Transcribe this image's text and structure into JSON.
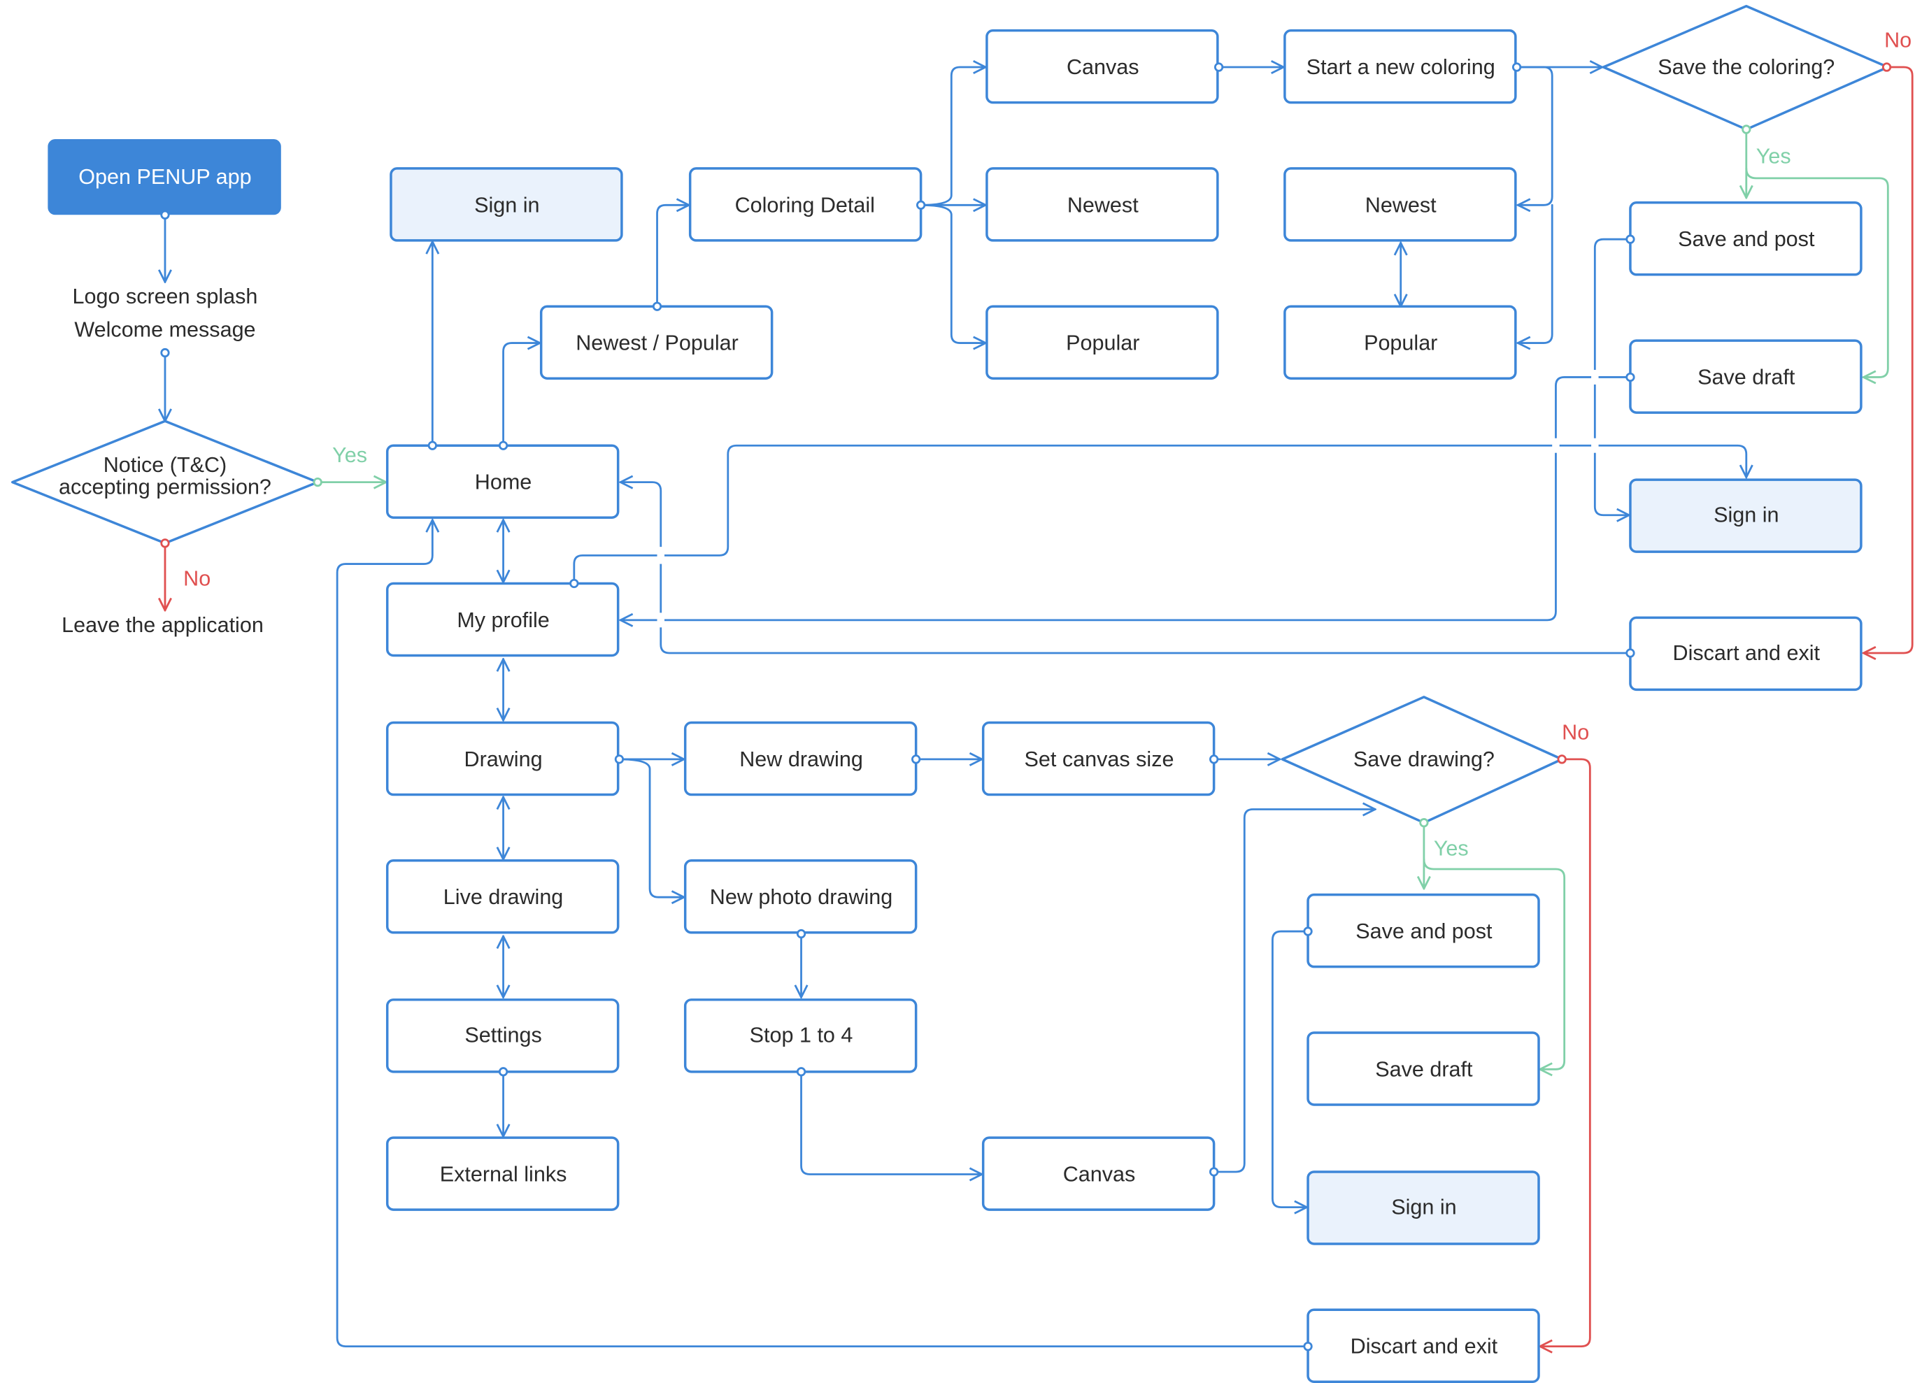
{
  "colors": {
    "flow": "#3d86d8",
    "yes": "#80d0a8",
    "no": "#e05050",
    "highlight_fill": "#eaf2fc",
    "text": "#2b2b2b"
  },
  "nodes": {
    "open_app": {
      "label": "Open PENUP app",
      "kind": "start"
    },
    "splash_line1": {
      "label": "Logo screen splash"
    },
    "splash_line2": {
      "label": "Welcome message"
    },
    "notice_line1": {
      "label": "Notice (T&C)"
    },
    "notice_line2": {
      "label": "accepting permission?"
    },
    "leave_app": {
      "label": "Leave the application"
    },
    "sign_in_top": {
      "label": "Sign in",
      "kind": "highlight"
    },
    "home": {
      "label": "Home"
    },
    "newest_popular": {
      "label": "Newest / Popular"
    },
    "coloring_detail": {
      "label": "Coloring Detail"
    },
    "canvas_top": {
      "label": "Canvas"
    },
    "newest_a": {
      "label": "Newest"
    },
    "popular_a": {
      "label": "Popular"
    },
    "start_new_coloring": {
      "label": "Start a new coloring"
    },
    "newest_b": {
      "label": "Newest"
    },
    "popular_b": {
      "label": "Popular"
    },
    "save_coloring_q": {
      "label": "Save the coloring?",
      "kind": "decision"
    },
    "save_post_top": {
      "label": "Save and post"
    },
    "save_draft_top": {
      "label": "Save draft"
    },
    "sign_in_right": {
      "label": "Sign in",
      "kind": "highlight"
    },
    "discard_top": {
      "label": "Discart and exit"
    },
    "my_profile": {
      "label": "My profile"
    },
    "drawing": {
      "label": "Drawing"
    },
    "live_drawing": {
      "label": "Live drawing"
    },
    "settings": {
      "label": "Settings"
    },
    "external_links": {
      "label": "External links"
    },
    "new_drawing": {
      "label": "New drawing"
    },
    "new_photo_drawing": {
      "label": "New photo drawing"
    },
    "stop_1_4": {
      "label": "Stop 1 to 4"
    },
    "set_canvas_size": {
      "label": "Set canvas size"
    },
    "canvas_bottom": {
      "label": "Canvas"
    },
    "save_drawing_q": {
      "label": "Save drawing?",
      "kind": "decision"
    },
    "save_post_bottom": {
      "label": "Save and post"
    },
    "save_draft_bottom": {
      "label": "Save draft"
    },
    "sign_in_bottom": {
      "label": "Sign in",
      "kind": "highlight"
    },
    "discard_bottom": {
      "label": "Discart and exit"
    }
  },
  "edge_labels": {
    "notice_yes": "Yes",
    "notice_no": "No",
    "coloring_yes": "Yes",
    "coloring_no": "No",
    "drawing_yes": "Yes",
    "drawing_no": "No"
  }
}
